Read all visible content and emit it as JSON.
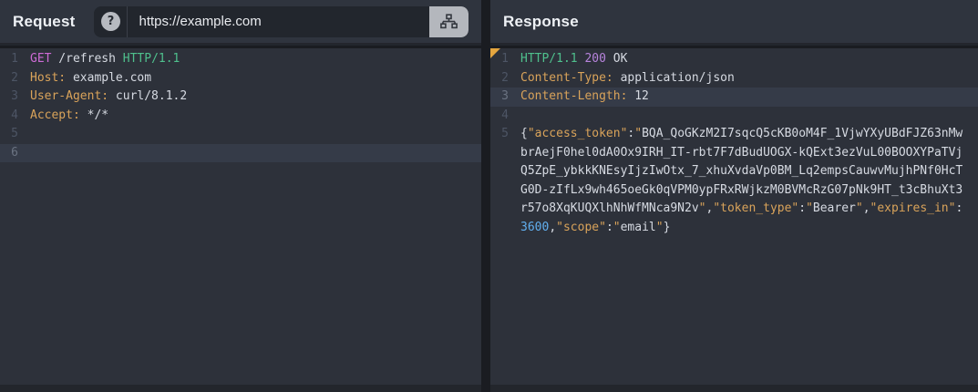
{
  "palette": {
    "background": "#2d313a",
    "header_bar": "#2f343e",
    "active_line": "#353b48",
    "accent_orange": "#d9a35a",
    "accent_pink": "#ce6bd6",
    "accent_green": "#4fc08d",
    "accent_purple": "#b884dd",
    "accent_blue": "#61afef",
    "fold_marker": "#e5a63f"
  },
  "request_panel": {
    "title": "Request",
    "url_bar": {
      "help_icon": "question-mark-circle",
      "url": "https://example.com",
      "send_icon": "sitemap"
    },
    "editor": {
      "lines": [
        {
          "num": "1",
          "segments": [
            {
              "color": "pink",
              "text": "GET"
            },
            {
              "color": "white",
              "text": " /refresh "
            },
            {
              "color": "green",
              "text": "HTTP/1.1"
            }
          ]
        },
        {
          "num": "2",
          "segments": [
            {
              "color": "orange",
              "text": "Host:"
            },
            {
              "color": "white",
              "text": " example.com"
            }
          ]
        },
        {
          "num": "3",
          "segments": [
            {
              "color": "orange",
              "text": "User-Agent:"
            },
            {
              "color": "white",
              "text": " curl/8.1.2"
            }
          ]
        },
        {
          "num": "4",
          "segments": [
            {
              "color": "orange",
              "text": "Accept:"
            },
            {
              "color": "white",
              "text": " */*"
            }
          ]
        },
        {
          "num": "5",
          "segments": []
        },
        {
          "num": "6",
          "active": true,
          "segments": []
        }
      ]
    }
  },
  "response_panel": {
    "title": "Response",
    "status_line": "HTTP/1.1 200 OK",
    "access_token_full": "BQA_QoGKzM2I7sqcQ5cKB0oM4F_1VjwYXyUBdFJZ63nMwbrAejF0hel0dA0Ox9IRH_IT-rbt7F7dBudUOGX-kQExt3ezVuL00BOOXYPaTVjQ5ZpE_ybkkKNEsyIjzIwOtx_7_xhuXvdaVp0BM_Lq2empsCauwvMujhPNf0HcTG0D-zIfLx9wh465oeGk0qVPM0ypFRxRWjkzM0BVMcRzG07pNk9HT_t3cBhuXt3r57o8XqKUQXlhNhWfMNca9N2v",
    "editor": {
      "lines": [
        {
          "num": "1",
          "segments": [
            {
              "color": "green",
              "text": "HTTP/1.1"
            },
            {
              "color": "white",
              "text": " "
            },
            {
              "color": "purple",
              "text": "200"
            },
            {
              "color": "white",
              "text": " OK"
            }
          ]
        },
        {
          "num": "2",
          "segments": [
            {
              "color": "orange",
              "text": "Content-Type:"
            },
            {
              "color": "white",
              "text": " application/json"
            }
          ]
        },
        {
          "num": "3",
          "active": true,
          "segments": [
            {
              "color": "orange",
              "text": "Content-Length:"
            },
            {
              "color": "white",
              "text": " 12"
            }
          ]
        },
        {
          "num": "4",
          "segments": []
        },
        {
          "num": "5",
          "segments": [
            {
              "color": "white",
              "text": "{"
            },
            {
              "color": "orange",
              "text": "\"access_token\""
            },
            {
              "color": "white",
              "text": ":"
            },
            {
              "color": "orange",
              "text": "\""
            },
            {
              "color": "white",
              "text": "BQA_QoGKzM2I7sqcQ5cKB0oM4F_1VjwYXyUBdFJZ63nMw"
            }
          ]
        },
        {
          "num": "",
          "segments": [
            {
              "color": "white",
              "text": "brAejF0hel0dA0Ox9IRH_IT-rbt7F7dBudUOGX-kQExt3ezVuL00BOOXYPaTVj"
            }
          ]
        },
        {
          "num": "",
          "segments": [
            {
              "color": "white",
              "text": "Q5ZpE_ybkkKNEsyIjzIwOtx_7_xhuXvdaVp0BM_Lq2empsCauwvMujhPNf0HcT"
            }
          ]
        },
        {
          "num": "",
          "segments": [
            {
              "color": "white",
              "text": "G0D-zIfLx9wh465oeGk0qVPM0ypFRxRWjkzM0BVMcRzG07pNk9HT_t3cBhuXt3"
            }
          ]
        },
        {
          "num": "",
          "segments": [
            {
              "color": "white",
              "text": "r57o8XqKUQXlhNhWfMNca9N2v"
            },
            {
              "color": "orange",
              "text": "\""
            },
            {
              "color": "white",
              "text": ","
            },
            {
              "color": "orange",
              "text": "\"token_type\""
            },
            {
              "color": "white",
              "text": ":"
            },
            {
              "color": "orange",
              "text": "\""
            },
            {
              "color": "white",
              "text": "Bearer"
            },
            {
              "color": "orange",
              "text": "\""
            },
            {
              "color": "white",
              "text": ","
            },
            {
              "color": "orange",
              "text": "\"expires_in\""
            },
            {
              "color": "white",
              "text": ":"
            }
          ]
        },
        {
          "num": "",
          "segments": [
            {
              "color": "blue",
              "text": "3600"
            },
            {
              "color": "white",
              "text": ","
            },
            {
              "color": "orange",
              "text": "\"scope\""
            },
            {
              "color": "white",
              "text": ":"
            },
            {
              "color": "orange",
              "text": "\""
            },
            {
              "color": "white",
              "text": "email"
            },
            {
              "color": "orange",
              "text": "\""
            },
            {
              "color": "white",
              "text": "}"
            }
          ]
        }
      ]
    }
  }
}
